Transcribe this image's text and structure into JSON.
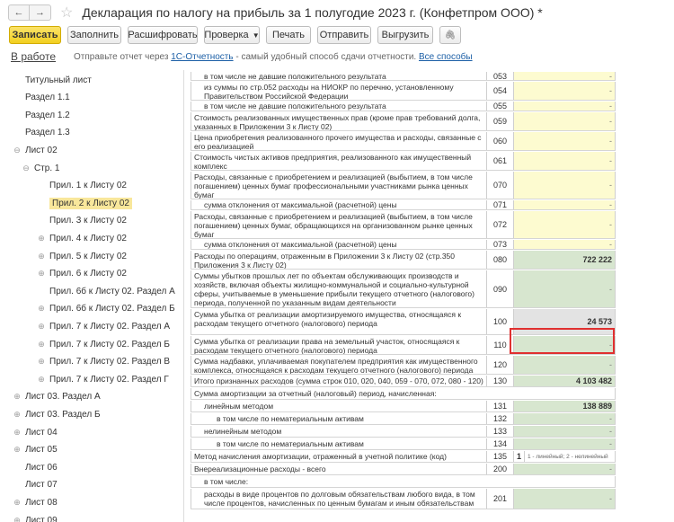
{
  "window": {
    "title": "Декларация по налогу на прибыль за 1 полугодие 2023 г. (Конфетпром ООО) *"
  },
  "nav": {
    "back_glyph": "←",
    "forward_glyph": "→",
    "favorite_glyph": "☆"
  },
  "toolbar": {
    "record": "Записать",
    "fill": "Заполнить",
    "decode": "Расшифровать",
    "check": "Проверка",
    "print": "Печать",
    "send": "Отправить",
    "export": "Выгрузить",
    "attach_glyph": "🖇"
  },
  "info": {
    "in_work": "В работе",
    "text_before": "Отправьте отчет через ",
    "link_1c": "1С-Отчетность",
    "text_after": " - самый удобный способ сдачи отчетности. ",
    "link_all": "Все способы"
  },
  "sidebar": {
    "items": [
      {
        "label": "Титульный лист",
        "exp": ""
      },
      {
        "label": "Раздел 1.1",
        "exp": ""
      },
      {
        "label": "Раздел 1.2",
        "exp": ""
      },
      {
        "label": "Раздел 1.3",
        "exp": ""
      },
      {
        "label": "Лист 02",
        "exp": "⊖"
      },
      {
        "label": "Стр. 1",
        "exp": "⊖"
      },
      {
        "label": "Прил. 1 к Листу 02",
        "exp": ""
      },
      {
        "label": "Прил. 2 к Листу 02",
        "exp": "",
        "selected": true
      },
      {
        "label": "Прил. 3 к Листу 02",
        "exp": ""
      },
      {
        "label": "Прил. 4 к Листу 02",
        "exp": "⊕"
      },
      {
        "label": "Прил. 5 к Листу 02",
        "exp": "⊕"
      },
      {
        "label": "Прил. 6 к Листу 02",
        "exp": "⊕"
      },
      {
        "label": "Прил. 6б к Листу 02. Раздел А",
        "exp": ""
      },
      {
        "label": "Прил. 6б к Листу 02. Раздел Б",
        "exp": "⊕"
      },
      {
        "label": "Прил. 7 к Листу 02. Раздел А",
        "exp": "⊕"
      },
      {
        "label": "Прил. 7 к Листу 02. Раздел Б",
        "exp": "⊕"
      },
      {
        "label": "Прил. 7 к Листу 02. Раздел В",
        "exp": "⊕"
      },
      {
        "label": "Прил. 7 к Листу 02. Раздел Г",
        "exp": "⊕"
      },
      {
        "label": "Лист 03. Раздел А",
        "exp": "⊕"
      },
      {
        "label": "Лист 03. Раздел Б",
        "exp": "⊕"
      },
      {
        "label": "Лист 04",
        "exp": "⊕"
      },
      {
        "label": "Лист 05",
        "exp": "⊕"
      },
      {
        "label": "Лист 06",
        "exp": ""
      },
      {
        "label": "Лист 07",
        "exp": ""
      },
      {
        "label": "Лист 08",
        "exp": "⊕"
      },
      {
        "label": "Лист 09",
        "exp": "⊕"
      }
    ]
  },
  "table": {
    "rows": [
      {
        "desc": "в том числе не давшие положительного результата",
        "code": "053",
        "value": "-",
        "style": "yellow",
        "indent": true
      },
      {
        "desc": "из суммы по стр.052 расходы на НИОКР по перечню, установленному Правительством Российской Федерации",
        "code": "054",
        "value": "-",
        "style": "yellow",
        "indent": true
      },
      {
        "desc": "в том числе не давшие положительного результата",
        "code": "055",
        "value": "-",
        "style": "yellow",
        "indent": true
      },
      {
        "desc": "Стоимость реализованных имущественных прав (кроме прав требований долга, указанных в Приложении 3 к Листу 02)",
        "code": "059",
        "value": "-",
        "style": "yellow"
      },
      {
        "desc": "Цена приобретения реализованного прочего имущества и расходы, связанные с его реализацией",
        "code": "060",
        "value": "-",
        "style": "yellow"
      },
      {
        "desc": "Стоимость чистых активов предприятия, реализованного как имущественный комплекс",
        "code": "061",
        "value": "-",
        "style": "yellow"
      },
      {
        "desc": "Расходы, связанные с приобретением и реализацией (выбытием, в том числе погашением) ценных бумаг профессиональными участниками рынка ценных бумаг",
        "code": "070",
        "value": "-",
        "style": "yellow"
      },
      {
        "desc": "сумма отклонения от максимальной (расчетной) цены",
        "code": "071",
        "value": "-",
        "style": "yellow",
        "indent": true
      },
      {
        "desc": "Расходы, связанные с приобретением и реализацией (выбытием, в том числе погашением) ценных бумаг, обращающихся на организованном рынке ценных бумаг",
        "code": "072",
        "value": "-",
        "style": "yellow"
      },
      {
        "desc": "сумма отклонения от максимальной (расчетной) цены",
        "code": "073",
        "value": "-",
        "style": "yellow",
        "indent": true
      },
      {
        "desc": "Расходы по операциям, отраженным в Приложении 3 к Листу 02 (стр.350 Приложения 3 к Листу 02)",
        "code": "080",
        "value": "722 222",
        "style": "green"
      },
      {
        "desc": "Суммы убытков прошлых лет по объектам обслуживающих производств и хозяйств, включая объекты жилищно-коммунальной и социально-культурной сферы, учитываемые в уменьшение прибыли текущего отчетного (налогового) периода, полученной по указанным видам деятельности",
        "code": "090",
        "value": "-",
        "style": "green"
      },
      {
        "desc": "Сумма убытка от реализации амортизируемого имущества, относящаяся к расходам текущего отчетного (налогового) периода",
        "code": "100",
        "value": "24 573",
        "style": "highlight"
      },
      {
        "desc": "Сумма убытка от реализации права на земельный участок, относящаяся к расходам текущего отчетного (налогового) периода",
        "code": "110",
        "value": "-",
        "style": "green"
      },
      {
        "desc": "Сумма надбавки, уплачиваемая покупателем предприятия как имущественного комплекса, относящаяся к расходам текущего отчетного (налогового) периода",
        "code": "120",
        "value": "-",
        "style": "green"
      },
      {
        "desc": "Итого признанных расходов (сумма строк 010, 020, 040, 059 - 070, 072, 080 - 120)",
        "code": "130",
        "value": "4 103 482",
        "style": "green"
      },
      {
        "desc": "Сумма амортизации за отчетный (налоговый) период, начисленная:",
        "code": "",
        "value": "",
        "style": "none",
        "span": true
      },
      {
        "desc": "линейным методом",
        "code": "131",
        "value": "138 889",
        "style": "green",
        "indent": true
      },
      {
        "desc": "в том числе по нематериальным активам",
        "code": "132",
        "value": "-",
        "style": "green",
        "indent2": true
      },
      {
        "desc": "нелинейным методом",
        "code": "133",
        "value": "-",
        "style": "green",
        "indent": true
      },
      {
        "desc": "в том числе по нематериальным активам",
        "code": "134",
        "value": "-",
        "style": "green",
        "indent2": true
      },
      {
        "desc": "Метод начисления амортизации, отраженный в учетной политике (код)",
        "code": "135",
        "value": "1",
        "style": "split",
        "hint": "1 - линейный; 2 - нелинейный"
      },
      {
        "desc": "Внереализационные расходы - всего",
        "code": "200",
        "value": "-",
        "style": "green"
      },
      {
        "desc": "в том числе:",
        "code": "",
        "value": "",
        "style": "none",
        "span": true,
        "indent": true
      },
      {
        "desc": "расходы в виде процентов по долговым обязательствам любого вида, в том числе процентов, начисленных по ценным бумагам и иным обязательствам",
        "code": "201",
        "value": "-",
        "style": "green",
        "indent": true
      }
    ]
  },
  "colors": {
    "accent": "#f2cf1f",
    "selection": "#f8e79b",
    "input_cell": "#fdfbd0",
    "calc_cell": "#d7e6cf",
    "focus_border": "#e03030",
    "link": "#1c5fa6"
  }
}
